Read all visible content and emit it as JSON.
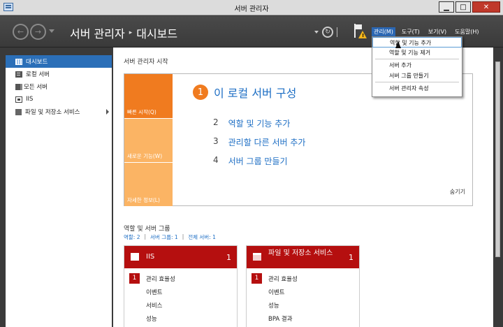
{
  "window": {
    "title": "서버 관리자",
    "btn_minimize": "▁",
    "btn_maximize": "□",
    "btn_close": "✕"
  },
  "header": {
    "breadcrumb_root": "서버 관리자",
    "breadcrumb_sep": "▸",
    "breadcrumb_current": "대시보드",
    "refresh_glyph": "↻",
    "menus": [
      {
        "label": "관리(M)"
      },
      {
        "label": "도구(T)"
      },
      {
        "label": "보기(V)"
      },
      {
        "label": "도움말(H)"
      }
    ]
  },
  "manage_menu": {
    "items": [
      {
        "label": "역할 및 기능 추가"
      },
      {
        "label": "역할 및 기능 제거"
      },
      {
        "label": "서버 추가"
      },
      {
        "label": "서버 그룹 만들기"
      },
      {
        "label": "서버 관리자 속성"
      }
    ]
  },
  "sidebar": {
    "items": [
      {
        "label": "대시보드"
      },
      {
        "label": "로컬 서버"
      },
      {
        "label": "모든 서버"
      },
      {
        "label": "IIS"
      },
      {
        "label": "파일 및 저장소 서비스"
      }
    ]
  },
  "welcome": {
    "title": "서버 관리자 시작",
    "tiles": [
      {
        "label": "빠른 시작(Q)"
      },
      {
        "label": "새로운 기능(W)"
      },
      {
        "label": "자세한 정보(L)"
      }
    ],
    "main_step": {
      "num": "1",
      "label": "이 로컬 서버 구성"
    },
    "steps": [
      {
        "num": "2",
        "label": "역할 및 기능 추가"
      },
      {
        "num": "3",
        "label": "관리할 다른 서버 추가"
      },
      {
        "num": "4",
        "label": "서버 그룹 만들기"
      }
    ],
    "hide_label": "숨기기"
  },
  "roles": {
    "title": "역할 및 서버 그룹",
    "counts": {
      "roles": "역할: 2",
      "groups": "서버 그룹: 1",
      "total": "전체 서버: 1",
      "pipe": "|"
    },
    "cards": [
      {
        "title": "IIS",
        "count": "1",
        "rows": [
          {
            "badge": "1",
            "label": "관리 효율성"
          },
          {
            "label": "이벤트"
          },
          {
            "label": "서비스"
          },
          {
            "label": "성능"
          }
        ]
      },
      {
        "title": "파일 및 저장소 서비스",
        "count": "1",
        "rows": [
          {
            "badge": "1",
            "label": "관리 효율성"
          },
          {
            "label": "이벤트"
          },
          {
            "label": "성능"
          },
          {
            "label": "BPA 결과"
          }
        ]
      }
    ]
  },
  "colors": {
    "accent_blue": "#2b6fb8",
    "orange": "#f07b1f",
    "light_orange": "#fbb464",
    "alert_red": "#b50f0f"
  }
}
